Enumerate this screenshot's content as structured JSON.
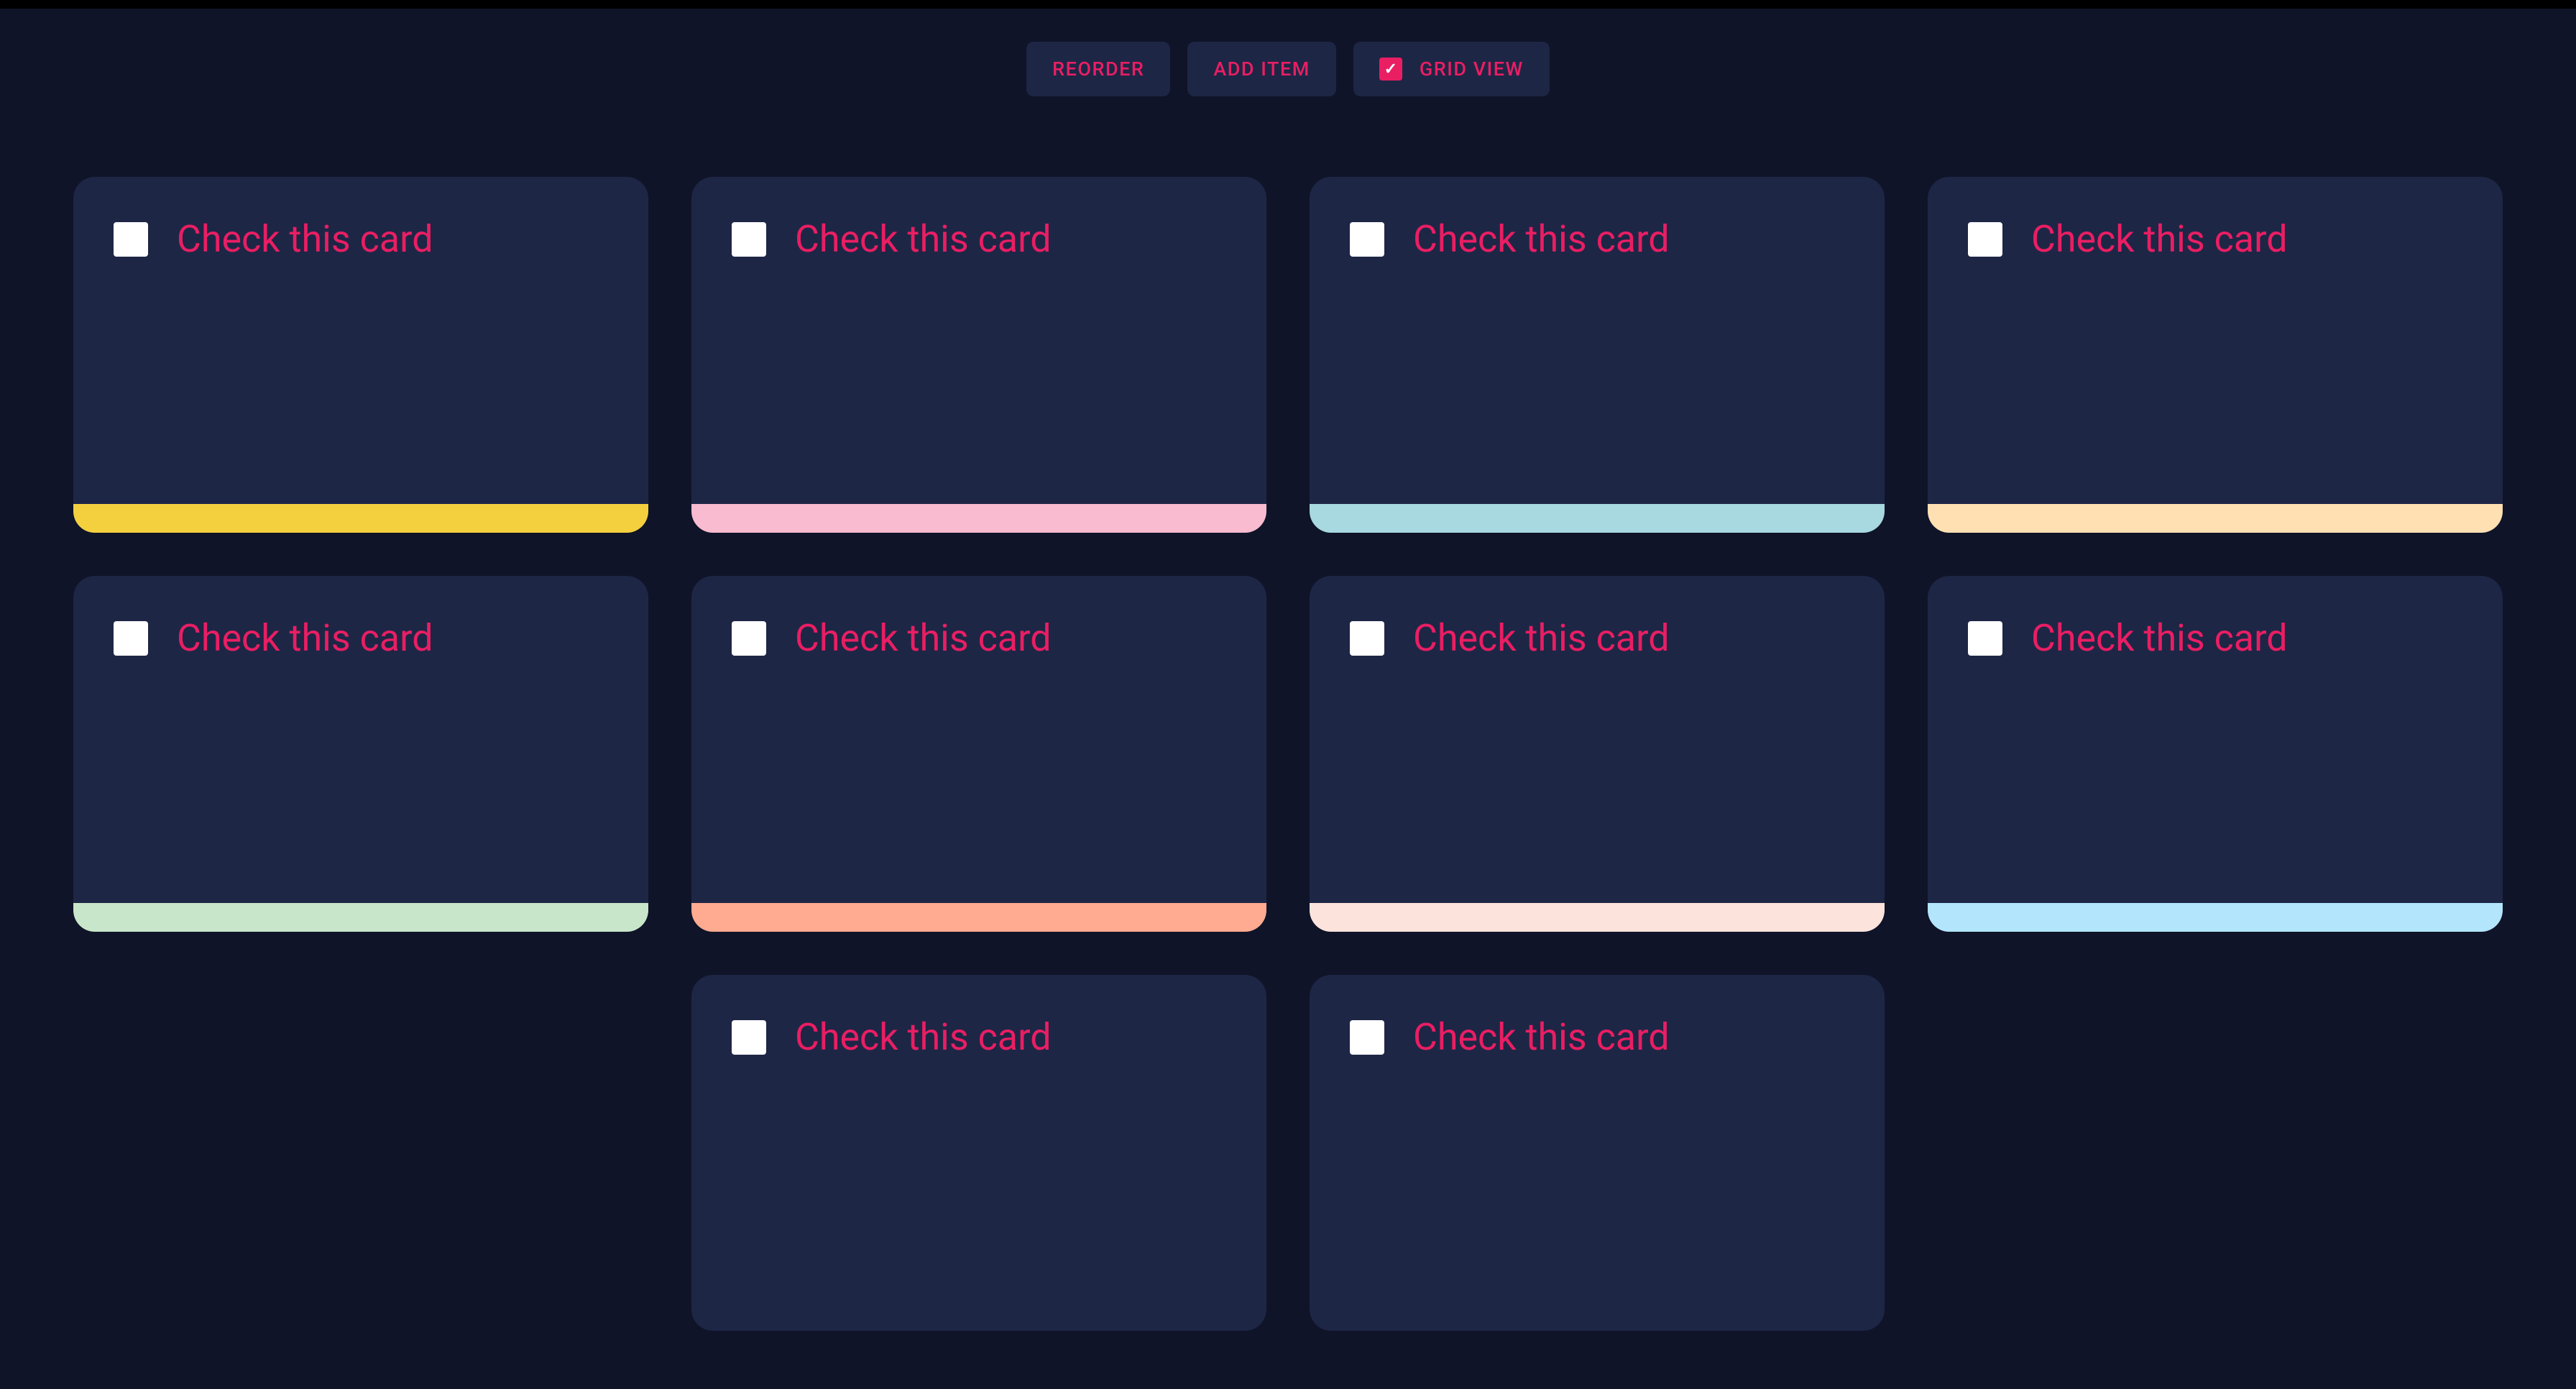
{
  "toolbar": {
    "reorder_label": "REORDER",
    "add_item_label": "ADD ITEM",
    "grid_view_label": "GRID VIEW",
    "grid_view_checked": true
  },
  "cards": [
    {
      "label": "Check this card",
      "checked": false,
      "accent_color": "#f4d03f"
    },
    {
      "label": "Check this card",
      "checked": false,
      "accent_color": "#f8bbd0"
    },
    {
      "label": "Check this card",
      "checked": false,
      "accent_color": "#a8d8e0"
    },
    {
      "label": "Check this card",
      "checked": false,
      "accent_color": "#ffe0b2"
    },
    {
      "label": "Check this card",
      "checked": false,
      "accent_color": "#c8e6c9"
    },
    {
      "label": "Check this card",
      "checked": false,
      "accent_color": "#ffab91"
    },
    {
      "label": "Check this card",
      "checked": false,
      "accent_color": "#fce4dc"
    },
    {
      "label": "Check this card",
      "checked": false,
      "accent_color": "#b3e5fc"
    },
    {
      "label": "Check this card",
      "checked": false,
      "accent_color": ""
    },
    {
      "label": "Check this card",
      "checked": false,
      "accent_color": ""
    }
  ]
}
